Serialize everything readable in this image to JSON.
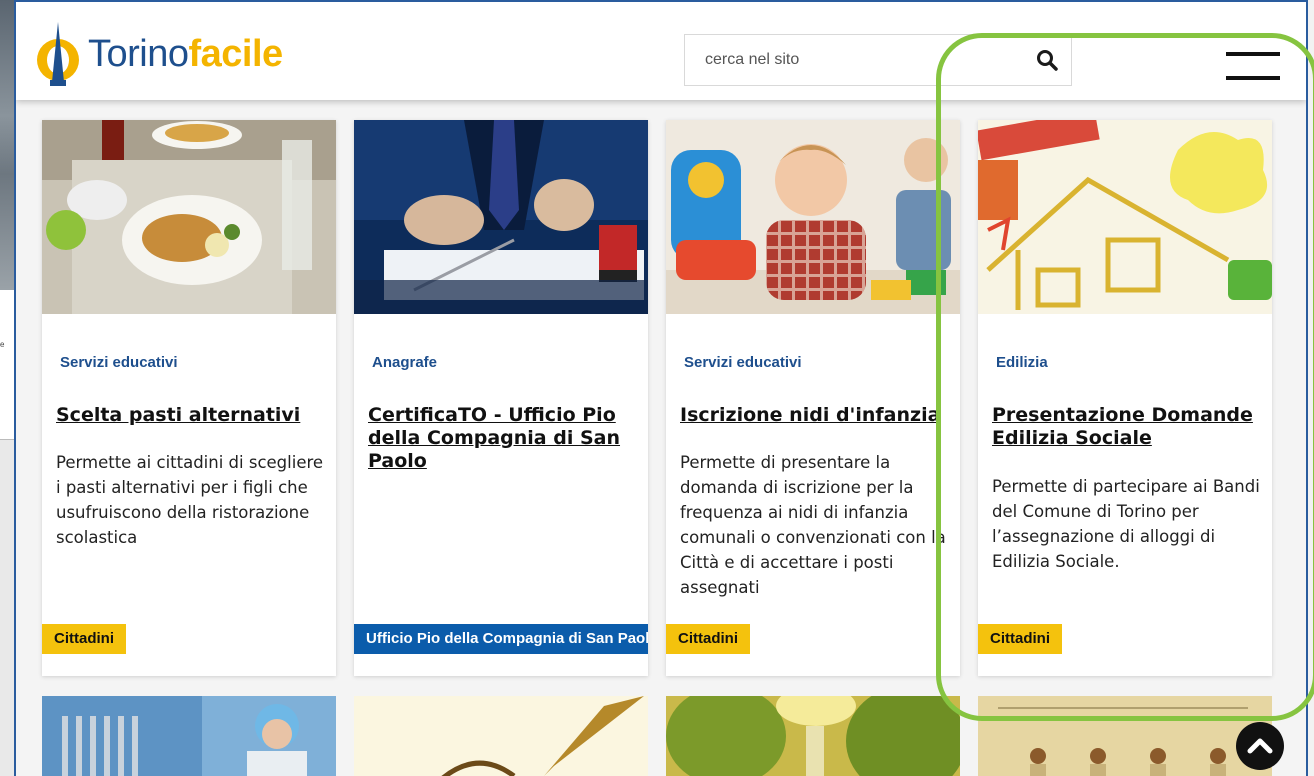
{
  "background_page": {
    "caption": "e"
  },
  "header": {
    "logo_plain": "Torino",
    "logo_bold": "facile",
    "search_placeholder": "cerca nel sito"
  },
  "colors": {
    "brand_blue": "#1e4f8d",
    "brand_yellow": "#f4b400",
    "tag_yellow": "#f4c20d",
    "tag_blue": "#0b5cab",
    "highlight_green": "#86c440"
  },
  "cards": [
    {
      "category": "Servizi educativi",
      "title": "Scelta pasti alternativi",
      "description": "Permette ai cittadini di scegliere i pasti alternativi per i figli che usufruiscono della ristorazione scolastica",
      "tag": "Cittadini",
      "image": "school-lunch-tray"
    },
    {
      "category": "Anagrafe",
      "title": "CertificaTO - Ufficio Pio della Compagnia di San Paolo",
      "description": "",
      "tag": "Ufficio Pio della Compagnia di San Paolo",
      "image": "signing-document"
    },
    {
      "category": "Servizi educativi",
      "title": "Iscrizione nidi d'infanzia",
      "description": "Permette di presentare la domanda di iscrizione per la frequenza ai nidi di infanzia comunali o convenzionati con la Città e di accettare i posti assegnati",
      "tag": "Cittadini",
      "image": "toddlers-playing"
    },
    {
      "category": "Edilizia",
      "title": "Presentazione Domande Edilizia Sociale",
      "description": "Permette di partecipare ai Bandi del Comune di Torino per l’assegnazione di alloggi di Edilizia Sociale.",
      "tag": "Cittadini",
      "image": "house-drawing"
    }
  ],
  "second_row_images": [
    "food-service-worker",
    "fountain-pen",
    "park-trees",
    "ancient-manuscript"
  ],
  "icons": {
    "search": "search-icon",
    "menu": "hamburger-menu-icon",
    "scroll_top": "chevron-up-icon"
  }
}
